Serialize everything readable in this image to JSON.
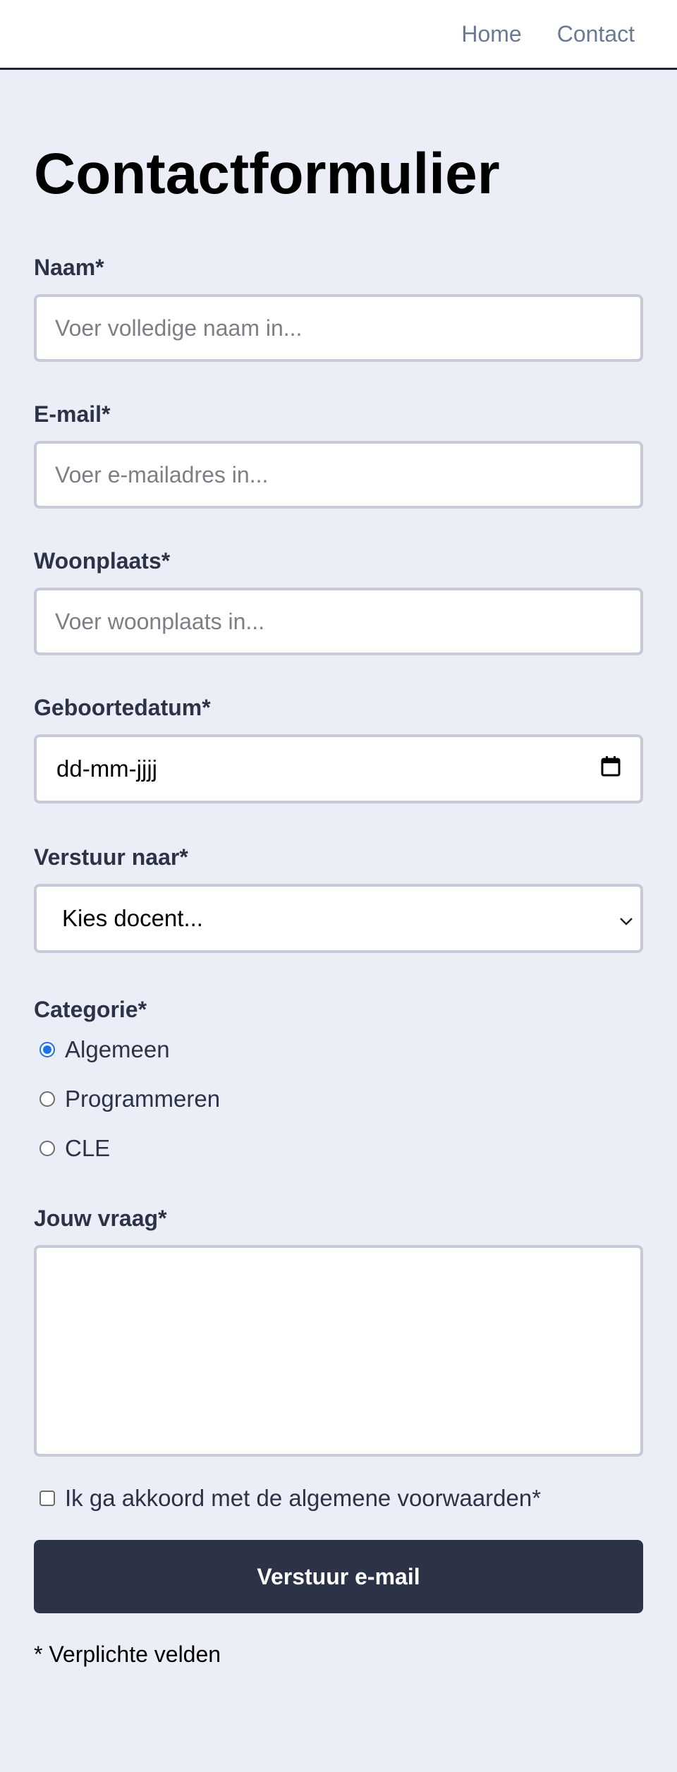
{
  "nav": {
    "items": [
      {
        "label": "Home"
      },
      {
        "label": "Contact"
      }
    ]
  },
  "page": {
    "title": "Contactformulier"
  },
  "form": {
    "name": {
      "label": "Naam*",
      "placeholder": "Voer volledige naam in..."
    },
    "email": {
      "label": "E-mail*",
      "placeholder": "Voer e-mailadres in..."
    },
    "city": {
      "label": "Woonplaats*",
      "placeholder": "Voer woonplaats in..."
    },
    "birthdate": {
      "label": "Geboortedatum*",
      "value": "dd-mm-jjjj",
      "icon": "calendar-icon"
    },
    "send_to": {
      "label": "Verstuur naar*",
      "selected": "Kies docent...",
      "icon": "chevron-down-icon"
    },
    "category": {
      "label": "Categorie*",
      "options": [
        {
          "label": "Algemeen",
          "checked": true
        },
        {
          "label": "Programmeren",
          "checked": false
        },
        {
          "label": "CLE",
          "checked": false
        }
      ]
    },
    "question": {
      "label": "Jouw vraag*",
      "value": ""
    },
    "terms": {
      "label": "Ik ga akkoord met de algemene voorwaarden*",
      "checked": false
    },
    "submit_label": "Verstuur e-mail",
    "required_note": "* Verplichte velden"
  },
  "colors": {
    "background": "#ebeef6",
    "button": "#2d3347",
    "radio_accent": "#1a73e8",
    "nav_link": "#6b7a94"
  }
}
